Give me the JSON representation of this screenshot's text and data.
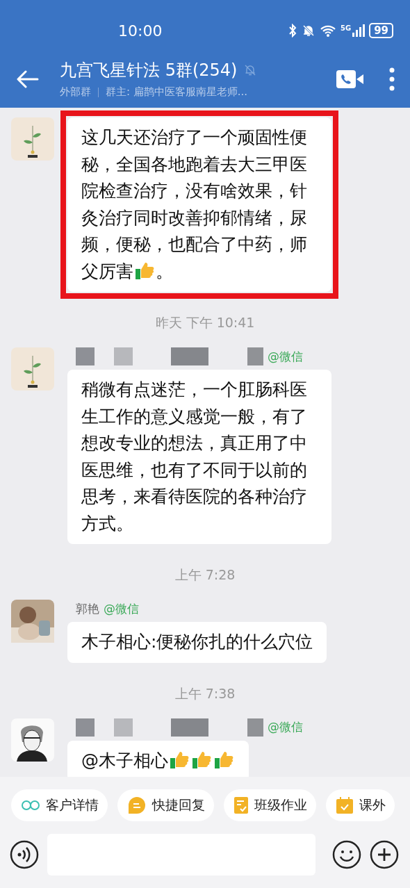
{
  "status_bar": {
    "time": "10:00",
    "network": "5G",
    "battery": "99"
  },
  "header": {
    "title": "九宫飞星针法 5群(254)",
    "muted": true,
    "group_type": "外部群",
    "owner": "群主: 扁鹊中医客服南星老师..."
  },
  "messages": [
    {
      "kind": "message",
      "avatar": {
        "kind": "plant"
      },
      "highlighted": true,
      "parts": [
        {
          "kind": "text",
          "text": "这几天还治疗了一个顽固性便秘，全国各地跑着去大三甲医院检查治疗，没有啥效果，针灸治疗同时改善抑郁情绪，尿频，便秘，也配合了中药，师"
        },
        {
          "kind": "text",
          "text": "父厉害"
        },
        {
          "kind": "thumbs_up"
        },
        {
          "kind": "text",
          "text": "。"
        }
      ]
    },
    {
      "kind": "time",
      "text": "昨天  下午 10:41"
    },
    {
      "kind": "message",
      "avatar": {
        "kind": "plant"
      },
      "highlighted": false,
      "sender_masked": true,
      "tag": "@微信",
      "parts": [
        {
          "kind": "text",
          "text": "稍微有点迷茫，一个肛肠科医生工作的意义感觉一般，有了想改专业的想法，真正用了中医思维，也有了不同于以前的思考，来看待医院的各种治疗方式。"
        }
      ]
    },
    {
      "kind": "time",
      "text": "上午 7:28"
    },
    {
      "kind": "message",
      "avatar": {
        "kind": "photo"
      },
      "highlighted": false,
      "sender": "郭艳",
      "tag": "@微信",
      "parts": [
        {
          "kind": "text",
          "text": "木子相心:便秘你扎的什么穴位"
        }
      ]
    },
    {
      "kind": "time",
      "text": "上午 7:38"
    },
    {
      "kind": "message",
      "avatar": {
        "kind": "sketch"
      },
      "highlighted": false,
      "sender_masked": true,
      "tag": "@微信",
      "parts": [
        {
          "kind": "text",
          "text": "@木子相心 "
        },
        {
          "kind": "thumbs_up"
        },
        {
          "kind": "thumbs_up"
        },
        {
          "kind": "thumbs_up"
        }
      ]
    }
  ],
  "shortcuts": [
    {
      "kind": "rings",
      "label": "客户详情"
    },
    {
      "kind": "reply",
      "label": "快捷回复"
    },
    {
      "kind": "homework",
      "label": "班级作业"
    },
    {
      "kind": "calendar",
      "label": "课外"
    }
  ]
}
